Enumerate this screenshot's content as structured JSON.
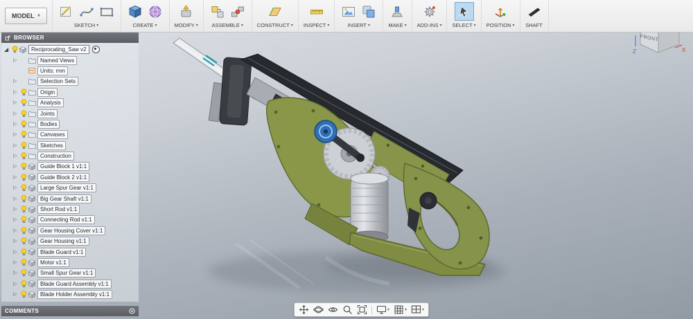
{
  "toolbar": {
    "model_menu": "MODEL",
    "groups": [
      {
        "label": "SKETCH",
        "caret": true,
        "icons": [
          "sketch-pad",
          "spline",
          "rectangle"
        ]
      },
      {
        "label": "CREATE",
        "caret": true,
        "icons": [
          "primitive-box",
          "form-sphere"
        ]
      },
      {
        "label": "MODIFY",
        "caret": true,
        "icons": [
          "press-pull"
        ]
      },
      {
        "label": "ASSEMBLE",
        "caret": true,
        "icons": [
          "new-component",
          "joint"
        ]
      },
      {
        "label": "CONSTRUCT",
        "caret": true,
        "icons": [
          "construction-plane"
        ]
      },
      {
        "label": "INSPECT",
        "caret": true,
        "icons": [
          "measure"
        ]
      },
      {
        "label": "INSERT",
        "caret": true,
        "icons": [
          "attached-canvas",
          "decal"
        ]
      },
      {
        "label": "MAKE",
        "caret": true,
        "icons": [
          "3d-print"
        ]
      },
      {
        "label": "ADD-INS",
        "caret": true,
        "icons": [
          "scripts-addins"
        ]
      },
      {
        "label": "SELECT",
        "caret": true,
        "icons": [
          "select-cursor"
        ],
        "selected": true
      },
      {
        "label": "POSITION",
        "caret": true,
        "icons": [
          "position-triad"
        ]
      },
      {
        "label": "SHAFT",
        "caret": false,
        "icons": [
          "shaft-blade"
        ]
      }
    ]
  },
  "browser": {
    "header": "BROWSER",
    "root": {
      "label": "Reciprocating_Saw v2"
    },
    "items": [
      {
        "label": "Named Views",
        "arrow": true,
        "bulb": false,
        "icon": "folder"
      },
      {
        "label": "Units: mm",
        "arrow": false,
        "bulb": false,
        "icon": "units"
      },
      {
        "label": "Selection Sets",
        "arrow": true,
        "bulb": false,
        "icon": "folder"
      },
      {
        "label": "Origin",
        "arrow": true,
        "bulb": true,
        "icon": "folder"
      },
      {
        "label": "Analysis",
        "arrow": true,
        "bulb": true,
        "icon": "folder"
      },
      {
        "label": "Joints",
        "arrow": true,
        "bulb": true,
        "icon": "folder"
      },
      {
        "label": "Bodies",
        "arrow": true,
        "bulb": true,
        "icon": "folder"
      },
      {
        "label": "Canvases",
        "arrow": true,
        "bulb": true,
        "icon": "folder"
      },
      {
        "label": "Sketches",
        "arrow": true,
        "bulb": true,
        "icon": "folder"
      },
      {
        "label": "Construction",
        "arrow": true,
        "bulb": true,
        "icon": "folder"
      },
      {
        "label": "Guide Block 1 v1:1",
        "arrow": true,
        "bulb": true,
        "icon": "component"
      },
      {
        "label": "Guide Block 2 v1:1",
        "arrow": true,
        "bulb": true,
        "icon": "component"
      },
      {
        "label": "Large Spur Gear v1:1",
        "arrow": true,
        "bulb": true,
        "icon": "component"
      },
      {
        "label": "Big Gear Shaft v1:1",
        "arrow": true,
        "bulb": true,
        "icon": "component"
      },
      {
        "label": "Short Rod v1:1",
        "arrow": true,
        "bulb": true,
        "icon": "component"
      },
      {
        "label": "Connecting Rod v1:1",
        "arrow": true,
        "bulb": true,
        "icon": "component"
      },
      {
        "label": "Gear Housing Cover v1:1",
        "arrow": true,
        "bulb": true,
        "icon": "component"
      },
      {
        "label": "Gear Housing v1:1",
        "arrow": true,
        "bulb": true,
        "icon": "component"
      },
      {
        "label": "Blade Guard v1:1",
        "arrow": true,
        "bulb": true,
        "icon": "component"
      },
      {
        "label": "Motor v1:1",
        "arrow": true,
        "bulb": true,
        "icon": "component"
      },
      {
        "label": "Small Spur Gear v1:1",
        "arrow": true,
        "bulb": true,
        "icon": "component"
      },
      {
        "label": "Blade Guard Assembly v1:1",
        "arrow": true,
        "bulb": true,
        "icon": "component"
      },
      {
        "label": "Blade Holder Assembly v1:1",
        "arrow": true,
        "bulb": true,
        "icon": "component"
      }
    ]
  },
  "comments": {
    "header": "COMMENTS"
  },
  "viewcube": {
    "front_label": "FRONT",
    "axes": {
      "z": "Z",
      "x": "X"
    }
  },
  "navbar": {
    "buttons": [
      {
        "icon": "pan"
      },
      {
        "icon": "orbit"
      },
      {
        "icon": "look-at"
      },
      {
        "icon": "zoom"
      },
      {
        "icon": "fit"
      },
      {
        "separator": true
      },
      {
        "icon": "display-settings",
        "caret": true
      },
      {
        "icon": "grid-display",
        "caret": true
      },
      {
        "icon": "viewports",
        "caret": true
      }
    ]
  },
  "colors": {
    "selection_highlight": "#bcd9ef",
    "model_body_green": "#8a9749",
    "pulley_blue": "#2f6fb4"
  }
}
